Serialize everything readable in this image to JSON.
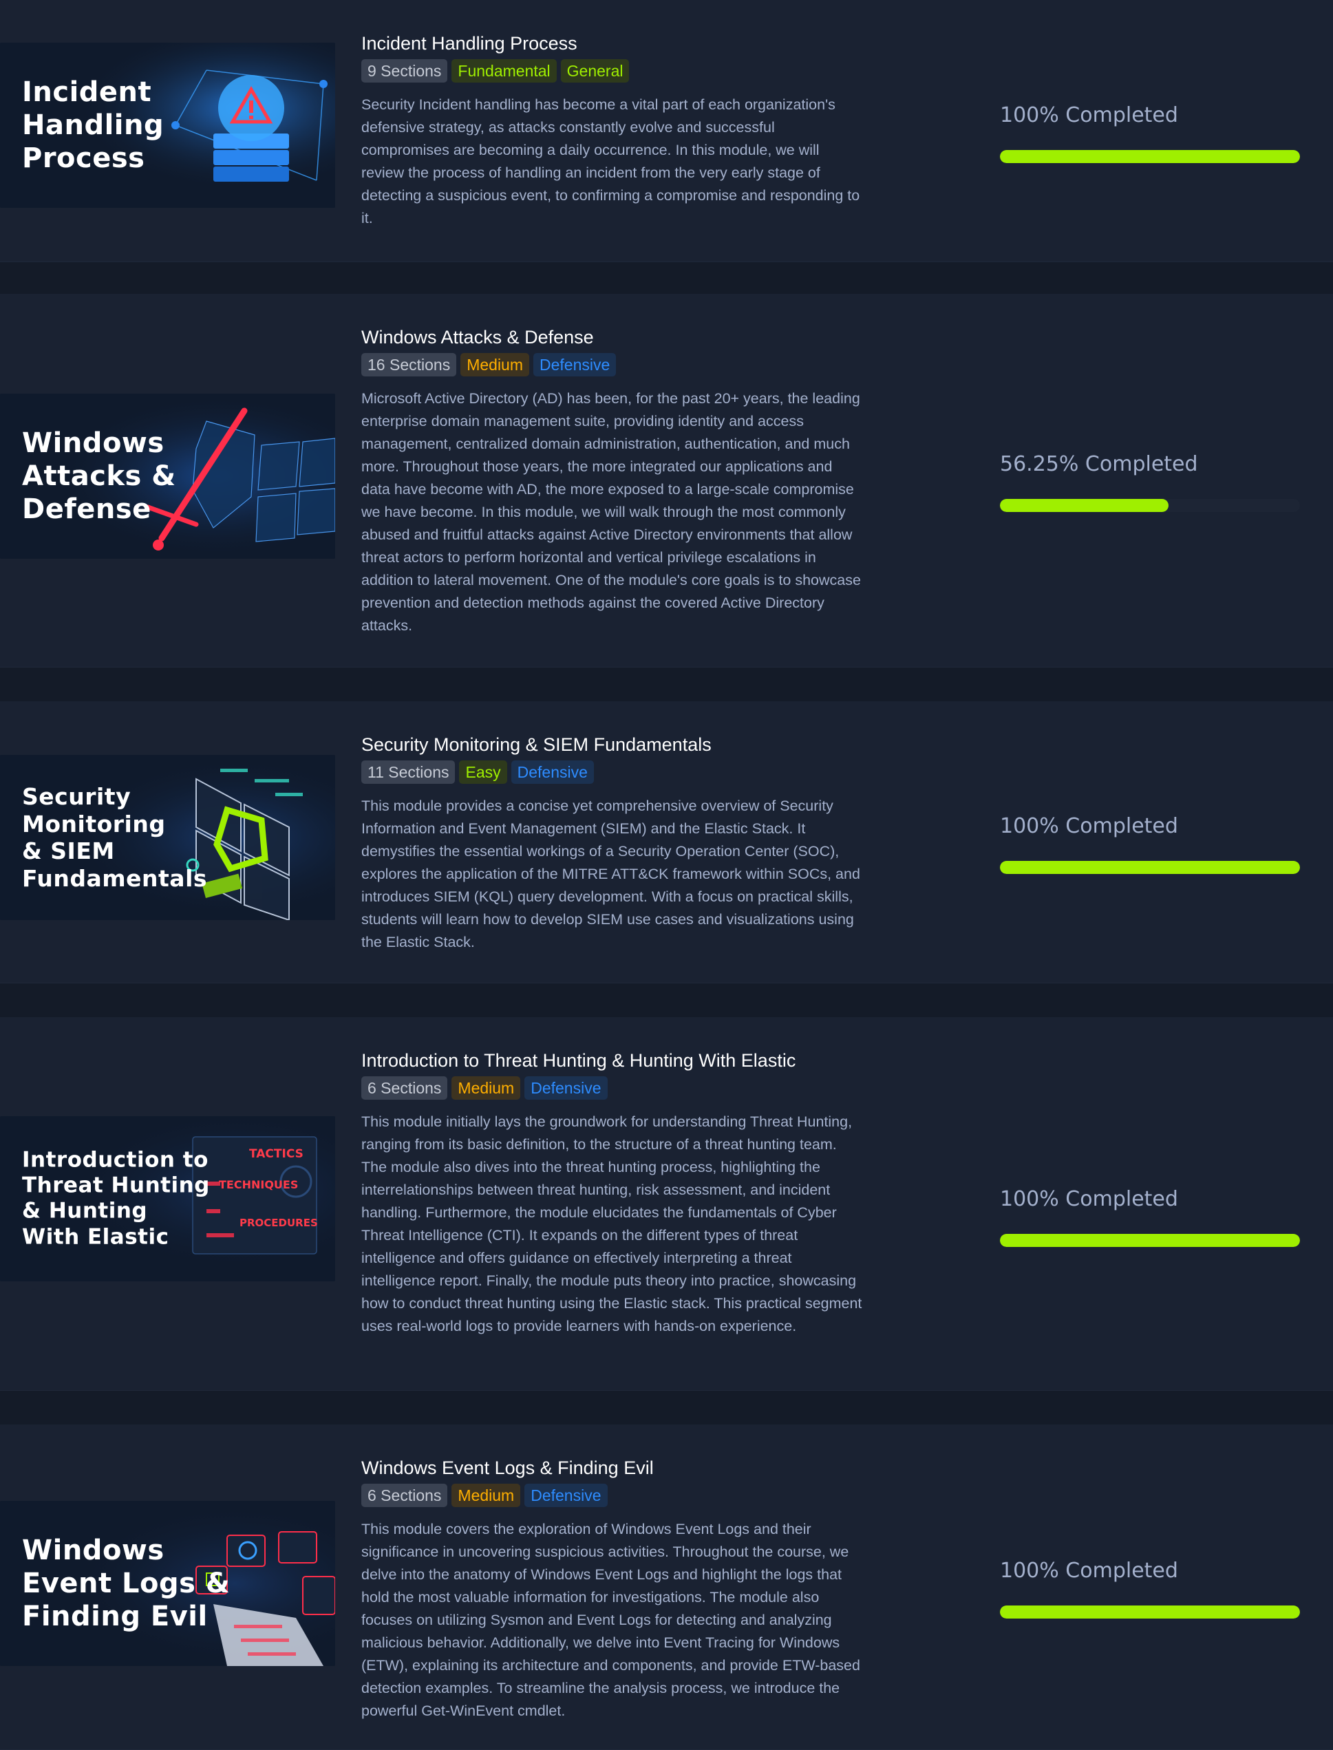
{
  "modules": [
    {
      "thumbnail_title": "Incident\nHandling\nProcess",
      "title": "Incident Handling Process",
      "sections": "9 Sections",
      "difficulty": "Fundamental",
      "category": "General",
      "description": "Security Incident handling has become a vital part of each organization's defensive strategy, as attacks constantly evolve and successful compromises are becoming a daily occurrence. In this module, we will review the process of handling an incident from the very early stage of detecting a suspicious event, to confirming a compromise and responding to it.",
      "progress_text": "100% Completed",
      "progress": 1.0
    },
    {
      "thumbnail_title": "Windows\nAttacks &\nDefense",
      "title": "Windows Attacks & Defense",
      "sections": "16 Sections",
      "difficulty": "Medium",
      "category": "Defensive",
      "description": "Microsoft Active Directory (AD) has been, for the past 20+ years, the leading enterprise domain management suite, providing identity and access management, centralized domain administration, authentication, and much more. Throughout those years, the more integrated our applications and data have become with AD, the more exposed to a large-scale compromise we have become. In this module, we will walk through the most commonly abused and fruitful attacks against Active Directory environments that allow threat actors to perform horizontal and vertical privilege escalations in addition to lateral movement. One of the module's core goals is to showcase prevention and detection methods against the covered Active Directory attacks.",
      "progress_text": "56.25% Completed",
      "progress": 0.5625
    },
    {
      "thumbnail_title": "Security\nMonitoring\n& SIEM\nFundamentals",
      "title": "Security Monitoring & SIEM Fundamentals",
      "sections": "11 Sections",
      "difficulty": "Easy",
      "category": "Defensive",
      "description": "This module provides a concise yet comprehensive overview of Security Information and Event Management (SIEM) and the Elastic Stack. It demystifies the essential workings of a Security Operation Center (SOC), explores the application of the MITRE ATT&CK framework within SOCs, and introduces SIEM (KQL) query development. With a focus on practical skills, students will learn how to develop SIEM use cases and visualizations using the Elastic Stack.",
      "progress_text": "100% Completed",
      "progress": 1.0
    },
    {
      "thumbnail_title": "Introduction to\nThreat Hunting\n& Hunting\nWith Elastic",
      "thumbnail_words": [
        "TACTICS",
        "TECHNIQUES",
        "PROCEDURES"
      ],
      "title": "Introduction to Threat Hunting & Hunting With Elastic",
      "sections": "6 Sections",
      "difficulty": "Medium",
      "category": "Defensive",
      "description": "This module initially lays the groundwork for understanding Threat Hunting, ranging from its basic definition, to the structure of a threat hunting team. The module also dives into the threat hunting process, highlighting the interrelationships between threat hunting, risk assessment, and incident handling. Furthermore, the module elucidates the fundamentals of Cyber Threat Intelligence (CTI). It expands on the different types of threat intelligence and offers guidance on effectively interpreting a threat intelligence report. Finally, the module puts theory into practice, showcasing how to conduct threat hunting using the Elastic stack. This practical segment uses real-world logs to provide learners with hands-on experience.",
      "progress_text": "100% Completed",
      "progress": 1.0
    },
    {
      "thumbnail_title": "Windows\nEvent Logs &\nFinding Evil",
      "title": "Windows Event Logs & Finding Evil",
      "sections": "6 Sections",
      "difficulty": "Medium",
      "category": "Defensive",
      "description": "This module covers the exploration of Windows Event Logs and their significance in uncovering suspicious activities. Throughout the course, we delve into the anatomy of Windows Event Logs and highlight the logs that hold the most valuable information for investigations. The module also focuses on utilizing Sysmon and Event Logs for detecting and analyzing malicious behavior. Additionally, we delve into Event Tracing for Windows (ETW), explaining its architecture and components, and provide ETW-based detection examples. To streamline the analysis process, we introduce the powerful Get-WinEvent cmdlet.",
      "progress_text": "100% Completed",
      "progress": 1.0
    }
  ],
  "colors": {
    "accent_green": "#9fef00",
    "medium_orange": "#ffaf00",
    "defensive_blue": "#2e8cff",
    "text_muted": "#a4b1cd"
  }
}
